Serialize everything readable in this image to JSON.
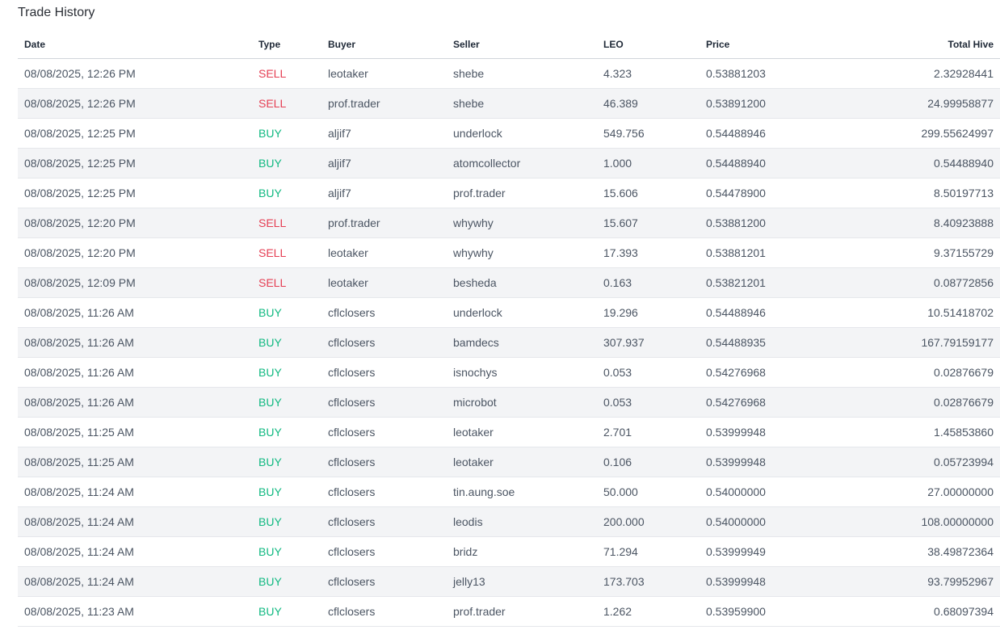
{
  "page": {
    "title": "Trade History"
  },
  "columns": [
    "Date",
    "Type",
    "Buyer",
    "Seller",
    "LEO",
    "Price",
    "Total Hive"
  ],
  "colors": {
    "sell": "#e53e53",
    "buy": "#10b981"
  },
  "rows": [
    {
      "date": "08/08/2025, 12:26 PM",
      "type": "SELL",
      "buyer": "leotaker",
      "seller": "shebe",
      "leo": "4.323",
      "price": "0.53881203",
      "total": "2.32928441"
    },
    {
      "date": "08/08/2025, 12:26 PM",
      "type": "SELL",
      "buyer": "prof.trader",
      "seller": "shebe",
      "leo": "46.389",
      "price": "0.53891200",
      "total": "24.99958877"
    },
    {
      "date": "08/08/2025, 12:25 PM",
      "type": "BUY",
      "buyer": "aljif7",
      "seller": "underlock",
      "leo": "549.756",
      "price": "0.54488946",
      "total": "299.55624997"
    },
    {
      "date": "08/08/2025, 12:25 PM",
      "type": "BUY",
      "buyer": "aljif7",
      "seller": "atomcollector",
      "leo": "1.000",
      "price": "0.54488940",
      "total": "0.54488940"
    },
    {
      "date": "08/08/2025, 12:25 PM",
      "type": "BUY",
      "buyer": "aljif7",
      "seller": "prof.trader",
      "leo": "15.606",
      "price": "0.54478900",
      "total": "8.50197713"
    },
    {
      "date": "08/08/2025, 12:20 PM",
      "type": "SELL",
      "buyer": "prof.trader",
      "seller": "whywhy",
      "leo": "15.607",
      "price": "0.53881200",
      "total": "8.40923888"
    },
    {
      "date": "08/08/2025, 12:20 PM",
      "type": "SELL",
      "buyer": "leotaker",
      "seller": "whywhy",
      "leo": "17.393",
      "price": "0.53881201",
      "total": "9.37155729"
    },
    {
      "date": "08/08/2025, 12:09 PM",
      "type": "SELL",
      "buyer": "leotaker",
      "seller": "besheda",
      "leo": "0.163",
      "price": "0.53821201",
      "total": "0.08772856"
    },
    {
      "date": "08/08/2025, 11:26 AM",
      "type": "BUY",
      "buyer": "cflclosers",
      "seller": "underlock",
      "leo": "19.296",
      "price": "0.54488946",
      "total": "10.51418702"
    },
    {
      "date": "08/08/2025, 11:26 AM",
      "type": "BUY",
      "buyer": "cflclosers",
      "seller": "bamdecs",
      "leo": "307.937",
      "price": "0.54488935",
      "total": "167.79159177"
    },
    {
      "date": "08/08/2025, 11:26 AM",
      "type": "BUY",
      "buyer": "cflclosers",
      "seller": "isnochys",
      "leo": "0.053",
      "price": "0.54276968",
      "total": "0.02876679"
    },
    {
      "date": "08/08/2025, 11:26 AM",
      "type": "BUY",
      "buyer": "cflclosers",
      "seller": "microbot",
      "leo": "0.053",
      "price": "0.54276968",
      "total": "0.02876679"
    },
    {
      "date": "08/08/2025, 11:25 AM",
      "type": "BUY",
      "buyer": "cflclosers",
      "seller": "leotaker",
      "leo": "2.701",
      "price": "0.53999948",
      "total": "1.45853860"
    },
    {
      "date": "08/08/2025, 11:25 AM",
      "type": "BUY",
      "buyer": "cflclosers",
      "seller": "leotaker",
      "leo": "0.106",
      "price": "0.53999948",
      "total": "0.05723994"
    },
    {
      "date": "08/08/2025, 11:24 AM",
      "type": "BUY",
      "buyer": "cflclosers",
      "seller": "tin.aung.soe",
      "leo": "50.000",
      "price": "0.54000000",
      "total": "27.00000000"
    },
    {
      "date": "08/08/2025, 11:24 AM",
      "type": "BUY",
      "buyer": "cflclosers",
      "seller": "leodis",
      "leo": "200.000",
      "price": "0.54000000",
      "total": "108.00000000"
    },
    {
      "date": "08/08/2025, 11:24 AM",
      "type": "BUY",
      "buyer": "cflclosers",
      "seller": "bridz",
      "leo": "71.294",
      "price": "0.53999949",
      "total": "38.49872364"
    },
    {
      "date": "08/08/2025, 11:24 AM",
      "type": "BUY",
      "buyer": "cflclosers",
      "seller": "jelly13",
      "leo": "173.703",
      "price": "0.53999948",
      "total": "93.79952967"
    },
    {
      "date": "08/08/2025, 11:23 AM",
      "type": "BUY",
      "buyer": "cflclosers",
      "seller": "prof.trader",
      "leo": "1.262",
      "price": "0.53959900",
      "total": "0.68097394"
    }
  ]
}
